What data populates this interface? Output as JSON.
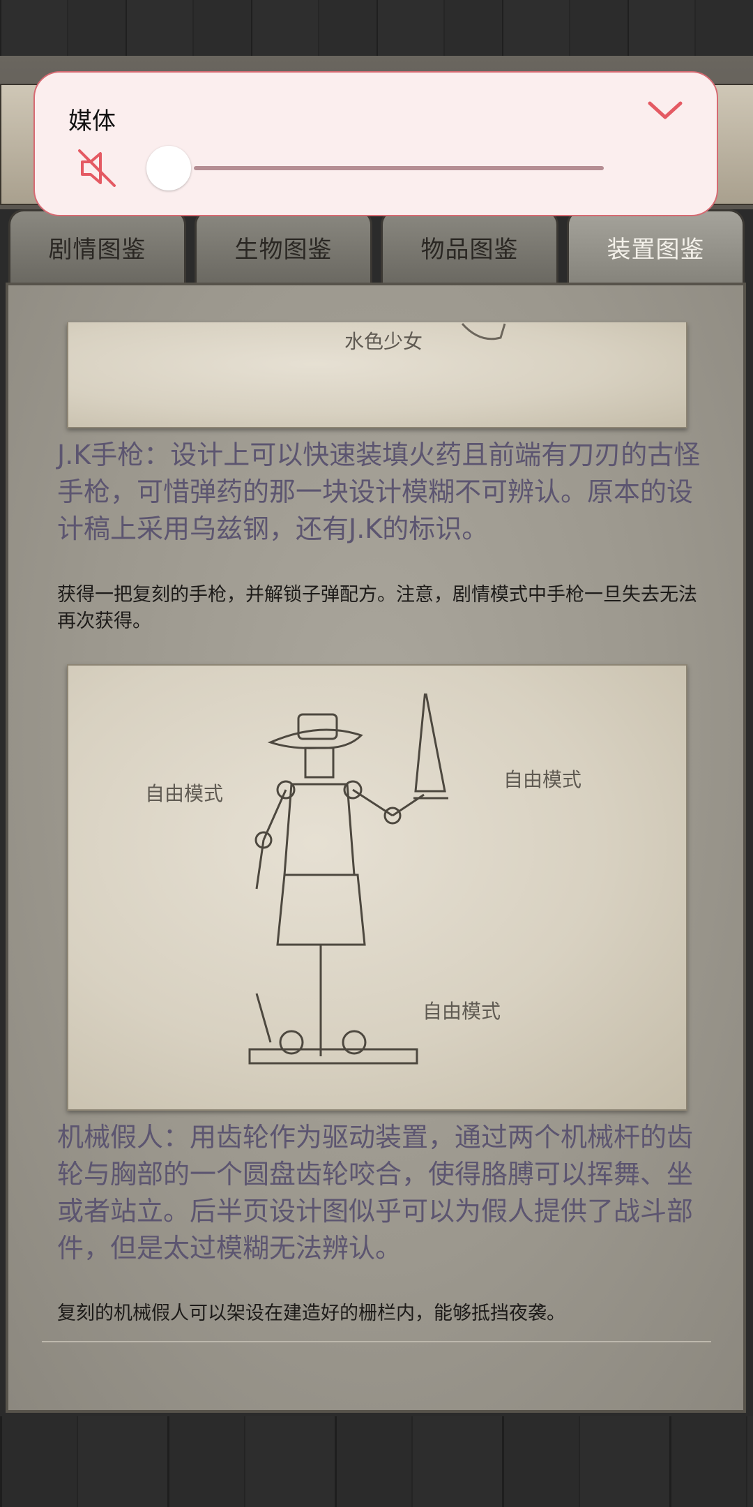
{
  "media": {
    "title": "媒体",
    "volume": 0,
    "muted": true,
    "icons": {
      "mute": "volume-mute-icon",
      "collapse": "chevron-down-icon"
    },
    "accent_color": "#e45a63"
  },
  "tabs": [
    {
      "label": "剧情图鉴",
      "active": false
    },
    {
      "label": "生物图鉴",
      "active": false
    },
    {
      "label": "物品图鉴",
      "active": false
    },
    {
      "label": "装置图鉴",
      "active": true
    }
  ],
  "entries": [
    {
      "image_labels": [
        "水色少女"
      ],
      "title": "J.K手枪：设计上可以快速装填火药且前端有刀刃的古怪手枪，可惜弹药的那一块设计模糊不可辨认。原本的设计稿上采用乌兹钢，还有J.K的标识。",
      "subtitle": "获得一把复刻的手枪，并解锁子弹配方。注意，剧情模式中手枪一旦失去无法再次获得。"
    },
    {
      "image_labels": [
        "自由模式",
        "自由模式",
        "自由模式"
      ],
      "title": "机械假人：用齿轮作为驱动装置，通过两个机械杆的齿轮与胸部的一个圆盘齿轮咬合，使得胳膊可以挥舞、坐或者站立。后半页设计图似乎可以为假人提供了战斗部件，但是太过模糊无法辨认。",
      "subtitle": "复刻的机械假人可以架设在建造好的栅栏内，能够抵挡夜袭。"
    }
  ]
}
